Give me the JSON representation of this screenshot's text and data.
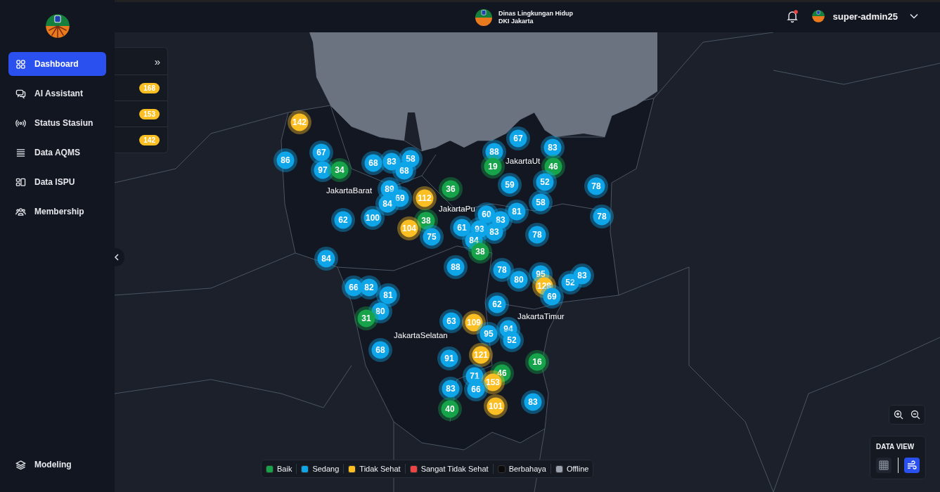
{
  "sidebar": {
    "items": [
      {
        "label": "Dashboard",
        "selected": true
      },
      {
        "label": "AI Assistant",
        "selected": false
      },
      {
        "label": "Status Stasiun",
        "selected": false
      },
      {
        "label": "Data AQMS",
        "selected": false
      },
      {
        "label": "Data ISPU",
        "selected": false
      },
      {
        "label": "Membership",
        "selected": false
      }
    ],
    "bottom_item": {
      "label": "Modeling",
      "selected": false
    }
  },
  "header": {
    "org_line_1": "Dinas Lingkungan Hidup",
    "org_line_2": "DKI Jakarta",
    "notification_unread": true,
    "username": "super-admin25"
  },
  "ranking_panel": {
    "expand_icon": "»",
    "rows": [
      {
        "value": "168"
      },
      {
        "value": "153"
      },
      {
        "value": "142"
      }
    ]
  },
  "map": {
    "districts": [
      {
        "label": "JakartaBarat"
      },
      {
        "label": "JakartaUt"
      },
      {
        "label": "JakartaPu"
      },
      {
        "label": "JakartaTimur"
      },
      {
        "label": "JakartaSelatan"
      }
    ],
    "markers": [
      {
        "value": "142",
        "color": "#fbbf24"
      },
      {
        "value": "86",
        "color": "#0ea5e9"
      },
      {
        "value": "67",
        "color": "#0ea5e9"
      },
      {
        "value": "97",
        "color": "#0ea5e9"
      },
      {
        "value": "34",
        "color": "#16a34a"
      },
      {
        "value": "68",
        "color": "#0ea5e9"
      },
      {
        "value": "83",
        "color": "#0ea5e9"
      },
      {
        "value": "58",
        "color": "#0ea5e9"
      },
      {
        "value": "68",
        "color": "#0ea5e9"
      },
      {
        "value": "89",
        "color": "#0ea5e9"
      },
      {
        "value": "69",
        "color": "#0ea5e9"
      },
      {
        "value": "84",
        "color": "#0ea5e9"
      },
      {
        "value": "112",
        "color": "#fbbf24"
      },
      {
        "value": "36",
        "color": "#16a34a"
      },
      {
        "value": "62",
        "color": "#0ea5e9"
      },
      {
        "value": "100",
        "color": "#0ea5e9"
      },
      {
        "value": "38",
        "color": "#16a34a"
      },
      {
        "value": "104",
        "color": "#fbbf24"
      },
      {
        "value": "75",
        "color": "#0ea5e9"
      },
      {
        "value": "61",
        "color": "#0ea5e9"
      },
      {
        "value": "60",
        "color": "#0ea5e9"
      },
      {
        "value": "93",
        "color": "#0ea5e9"
      },
      {
        "value": "83",
        "color": "#0ea5e9"
      },
      {
        "value": "83",
        "color": "#0ea5e9"
      },
      {
        "value": "84",
        "color": "#0ea5e9"
      },
      {
        "value": "81",
        "color": "#0ea5e9"
      },
      {
        "value": "88",
        "color": "#0ea5e9"
      },
      {
        "value": "19",
        "color": "#16a34a"
      },
      {
        "value": "67",
        "color": "#0ea5e9"
      },
      {
        "value": "83",
        "color": "#0ea5e9"
      },
      {
        "value": "46",
        "color": "#16a34a"
      },
      {
        "value": "52",
        "color": "#0ea5e9"
      },
      {
        "value": "59",
        "color": "#0ea5e9"
      },
      {
        "value": "58",
        "color": "#0ea5e9"
      },
      {
        "value": "78",
        "color": "#0ea5e9"
      },
      {
        "value": "78",
        "color": "#0ea5e9"
      },
      {
        "value": "78",
        "color": "#0ea5e9"
      },
      {
        "value": "38",
        "color": "#16a34a"
      },
      {
        "value": "88",
        "color": "#0ea5e9"
      },
      {
        "value": "78",
        "color": "#0ea5e9"
      },
      {
        "value": "80",
        "color": "#0ea5e9"
      },
      {
        "value": "95",
        "color": "#0ea5e9"
      },
      {
        "value": "128",
        "color": "#fbbf24"
      },
      {
        "value": "52",
        "color": "#0ea5e9"
      },
      {
        "value": "83",
        "color": "#0ea5e9"
      },
      {
        "value": "69",
        "color": "#0ea5e9"
      },
      {
        "value": "84",
        "color": "#0ea5e9"
      },
      {
        "value": "66",
        "color": "#0ea5e9"
      },
      {
        "value": "82",
        "color": "#0ea5e9"
      },
      {
        "value": "81",
        "color": "#0ea5e9"
      },
      {
        "value": "80",
        "color": "#0ea5e9"
      },
      {
        "value": "31",
        "color": "#16a34a"
      },
      {
        "value": "62",
        "color": "#0ea5e9"
      },
      {
        "value": "63",
        "color": "#0ea5e9"
      },
      {
        "value": "109",
        "color": "#fbbf24"
      },
      {
        "value": "95",
        "color": "#0ea5e9"
      },
      {
        "value": "94",
        "color": "#0ea5e9"
      },
      {
        "value": "52",
        "color": "#0ea5e9"
      },
      {
        "value": "68",
        "color": "#0ea5e9"
      },
      {
        "value": "91",
        "color": "#0ea5e9"
      },
      {
        "value": "121",
        "color": "#fbbf24"
      },
      {
        "value": "16",
        "color": "#16a34a"
      },
      {
        "value": "46",
        "color": "#16a34a"
      },
      {
        "value": "71",
        "color": "#0ea5e9"
      },
      {
        "value": "153",
        "color": "#fbbf24"
      },
      {
        "value": "66",
        "color": "#0ea5e9"
      },
      {
        "value": "83",
        "color": "#0ea5e9"
      },
      {
        "value": "40",
        "color": "#16a34a"
      },
      {
        "value": "101",
        "color": "#fbbf24"
      },
      {
        "value": "83",
        "color": "#0ea5e9"
      }
    ]
  },
  "legend": [
    {
      "label": "Baik",
      "color": "#16a34a"
    },
    {
      "label": "Sedang",
      "color": "#0ea5e9"
    },
    {
      "label": "Tidak Sehat",
      "color": "#fbbf24"
    },
    {
      "label": "Sangat Tidak Sehat",
      "color": "#ef4444"
    },
    {
      "label": "Berbahaya",
      "color": "#0b0b0b"
    },
    {
      "label": "Offline",
      "color": "#9ca3af"
    }
  ],
  "data_view": {
    "title": "DATA VIEW",
    "options": [
      {
        "selected": false
      },
      {
        "selected": true
      }
    ]
  }
}
